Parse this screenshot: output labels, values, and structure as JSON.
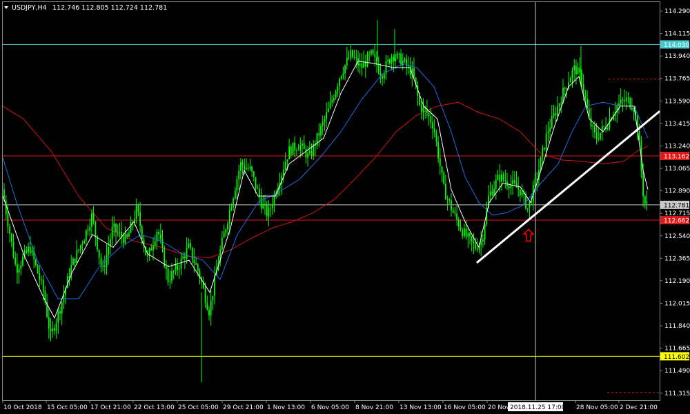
{
  "window": {
    "symbol": "USDJPY,H4",
    "ohlc": "112.746 112.805 112.724 112.781"
  },
  "colors": {
    "background": "#000000",
    "candle": "#00ff00",
    "ma_fast": "#ffffff",
    "ma_mid": "#1e6ee8",
    "ma_slow": "#d41414",
    "level_cyan": "#48c8c8",
    "level_red": "#e01818",
    "level_white": "#c8c8c8",
    "level_yellow": "#ffff00",
    "trendline": "#ffffff",
    "arrow": "#ff0000",
    "crosshair": "#c8c8c8",
    "axis_text": "#ffffff"
  },
  "chart_data": {
    "type": "candlestick",
    "symbol": "USDJPY",
    "timeframe": "H4",
    "ylim": [
      111.26,
      114.36
    ],
    "y_ticks": [
      "114.290",
      "114.115",
      "113.940",
      "113.765",
      "113.590",
      "113.415",
      "113.240",
      "113.065",
      "112.890",
      "112.715",
      "112.540",
      "112.365",
      "112.190",
      "112.015",
      "111.840",
      "111.665",
      "111.490",
      "111.315"
    ],
    "x_ticks": [
      "10 Oct 2018",
      "15 Oct 05:00",
      "17 Oct 21:00",
      "22 Oct 13:00",
      "25 Oct 05:00",
      "29 Oct 21:00",
      "1 Nov 13:00",
      "6 Nov 05:00",
      "8 Nov 21:00",
      "13 Nov 13:00",
      "16 Nov 05:00",
      "20 Nov",
      "28 Nov 05:00",
      "2 Dec 21:00"
    ],
    "crosshair_time": "2018.11.25 17:00",
    "horizontal_levels": [
      {
        "value": 114.03,
        "label": "114.030",
        "style": "cyan"
      },
      {
        "value": 113.162,
        "label": "113.162",
        "style": "red"
      },
      {
        "value": 112.781,
        "label": "112.781",
        "style": "white"
      },
      {
        "value": 112.662,
        "label": "112.662",
        "style": "red"
      },
      {
        "value": 111.602,
        "label": "111.602",
        "style": "yellow"
      }
    ],
    "dashed_levels": [
      113.76,
      111.32
    ],
    "trendline": {
      "from": {
        "time": "16 Nov 05:00",
        "price": 112.33
      },
      "to": {
        "time": "2 Dec 21:00",
        "price": 113.51
      }
    },
    "arrow_marker": {
      "time": "2018.11.25 17:00",
      "price": 112.59,
      "direction": "up"
    },
    "price_path": [
      [
        0,
        112.9
      ],
      [
        20,
        112.28
      ],
      [
        40,
        112.45
      ],
      [
        60,
        112.1
      ],
      [
        70,
        111.75
      ],
      [
        85,
        112.0
      ],
      [
        100,
        112.3
      ],
      [
        120,
        112.55
      ],
      [
        130,
        112.7
      ],
      [
        145,
        112.25
      ],
      [
        160,
        112.6
      ],
      [
        180,
        112.5
      ],
      [
        195,
        112.75
      ],
      [
        210,
        112.35
      ],
      [
        225,
        112.6
      ],
      [
        240,
        112.2
      ],
      [
        255,
        112.3
      ],
      [
        270,
        112.45
      ],
      [
        285,
        112.25
      ],
      [
        300,
        111.95
      ],
      [
        315,
        112.4
      ],
      [
        330,
        112.75
      ],
      [
        345,
        113.1
      ],
      [
        360,
        113.05
      ],
      [
        375,
        112.8
      ],
      [
        385,
        112.7
      ],
      [
        400,
        112.95
      ],
      [
        415,
        113.2
      ],
      [
        430,
        113.25
      ],
      [
        445,
        113.15
      ],
      [
        460,
        113.35
      ],
      [
        475,
        113.55
      ],
      [
        490,
        113.8
      ],
      [
        505,
        113.95
      ],
      [
        520,
        113.85
      ],
      [
        535,
        113.95
      ],
      [
        550,
        113.8
      ],
      [
        565,
        113.95
      ],
      [
        580,
        113.9
      ],
      [
        595,
        113.8
      ],
      [
        605,
        113.55
      ],
      [
        615,
        113.5
      ],
      [
        625,
        113.4
      ],
      [
        640,
        112.9
      ],
      [
        655,
        112.7
      ],
      [
        670,
        112.55
      ],
      [
        685,
        112.45
      ],
      [
        695,
        112.5
      ],
      [
        705,
        112.85
      ],
      [
        720,
        113.0
      ],
      [
        735,
        112.95
      ],
      [
        750,
        112.9
      ],
      [
        762,
        112.75
      ],
      [
        775,
        113.0
      ],
      [
        790,
        113.35
      ],
      [
        805,
        113.55
      ],
      [
        820,
        113.75
      ],
      [
        830,
        113.85
      ],
      [
        840,
        113.75
      ],
      [
        850,
        113.45
      ],
      [
        860,
        113.3
      ],
      [
        875,
        113.4
      ],
      [
        890,
        113.55
      ],
      [
        905,
        113.6
      ],
      [
        915,
        113.55
      ],
      [
        922,
        113.35
      ],
      [
        928,
        112.9
      ],
      [
        932,
        112.78
      ]
    ],
    "ma_fast_path": [
      [
        0,
        112.85
      ],
      [
        30,
        112.4
      ],
      [
        60,
        112.05
      ],
      [
        75,
        111.9
      ],
      [
        100,
        112.25
      ],
      [
        130,
        112.55
      ],
      [
        160,
        112.45
      ],
      [
        190,
        112.65
      ],
      [
        210,
        112.4
      ],
      [
        240,
        112.3
      ],
      [
        270,
        112.35
      ],
      [
        300,
        112.1
      ],
      [
        330,
        112.6
      ],
      [
        350,
        113.05
      ],
      [
        370,
        112.85
      ],
      [
        395,
        112.85
      ],
      [
        415,
        113.1
      ],
      [
        440,
        113.2
      ],
      [
        465,
        113.3
      ],
      [
        490,
        113.65
      ],
      [
        515,
        113.9
      ],
      [
        540,
        113.88
      ],
      [
        565,
        113.85
      ],
      [
        590,
        113.85
      ],
      [
        610,
        113.55
      ],
      [
        630,
        113.45
      ],
      [
        650,
        112.9
      ],
      [
        670,
        112.65
      ],
      [
        690,
        112.45
      ],
      [
        705,
        112.8
      ],
      [
        725,
        112.95
      ],
      [
        750,
        112.92
      ],
      [
        765,
        112.8
      ],
      [
        780,
        113.05
      ],
      [
        800,
        113.4
      ],
      [
        820,
        113.7
      ],
      [
        835,
        113.78
      ],
      [
        850,
        113.45
      ],
      [
        870,
        113.35
      ],
      [
        895,
        113.55
      ],
      [
        915,
        113.55
      ],
      [
        928,
        113.05
      ],
      [
        935,
        112.9
      ]
    ],
    "ma_mid_path": [
      [
        0,
        113.15
      ],
      [
        20,
        112.8
      ],
      [
        50,
        112.35
      ],
      [
        80,
        112.05
      ],
      [
        110,
        112.05
      ],
      [
        140,
        112.3
      ],
      [
        170,
        112.45
      ],
      [
        200,
        112.55
      ],
      [
        230,
        112.5
      ],
      [
        260,
        112.4
      ],
      [
        290,
        112.35
      ],
      [
        315,
        112.2
      ],
      [
        340,
        112.55
      ],
      [
        370,
        112.8
      ],
      [
        400,
        112.88
      ],
      [
        430,
        112.98
      ],
      [
        460,
        113.15
      ],
      [
        490,
        113.35
      ],
      [
        520,
        113.6
      ],
      [
        550,
        113.8
      ],
      [
        580,
        113.88
      ],
      [
        600,
        113.85
      ],
      [
        625,
        113.7
      ],
      [
        650,
        113.35
      ],
      [
        670,
        113.0
      ],
      [
        690,
        112.8
      ],
      [
        710,
        112.7
      ],
      [
        730,
        112.72
      ],
      [
        755,
        112.78
      ],
      [
        780,
        112.95
      ],
      [
        805,
        113.1
      ],
      [
        825,
        113.35
      ],
      [
        845,
        113.55
      ],
      [
        870,
        113.58
      ],
      [
        895,
        113.55
      ],
      [
        915,
        113.55
      ],
      [
        935,
        113.3
      ]
    ],
    "ma_slow_path": [
      [
        0,
        113.55
      ],
      [
        30,
        113.45
      ],
      [
        70,
        113.2
      ],
      [
        110,
        112.85
      ],
      [
        150,
        112.6
      ],
      [
        190,
        112.5
      ],
      [
        230,
        112.45
      ],
      [
        270,
        112.38
      ],
      [
        300,
        112.37
      ],
      [
        330,
        112.43
      ],
      [
        360,
        112.52
      ],
      [
        390,
        112.6
      ],
      [
        420,
        112.65
      ],
      [
        450,
        112.72
      ],
      [
        480,
        112.82
      ],
      [
        510,
        112.98
      ],
      [
        540,
        113.15
      ],
      [
        570,
        113.35
      ],
      [
        600,
        113.48
      ],
      [
        630,
        113.55
      ],
      [
        660,
        113.58
      ],
      [
        690,
        113.5
      ],
      [
        720,
        113.45
      ],
      [
        750,
        113.35
      ],
      [
        780,
        113.18
      ],
      [
        810,
        113.13
      ],
      [
        840,
        113.12
      ],
      [
        870,
        113.1
      ],
      [
        900,
        113.12
      ],
      [
        920,
        113.2
      ],
      [
        935,
        113.24
      ]
    ]
  }
}
